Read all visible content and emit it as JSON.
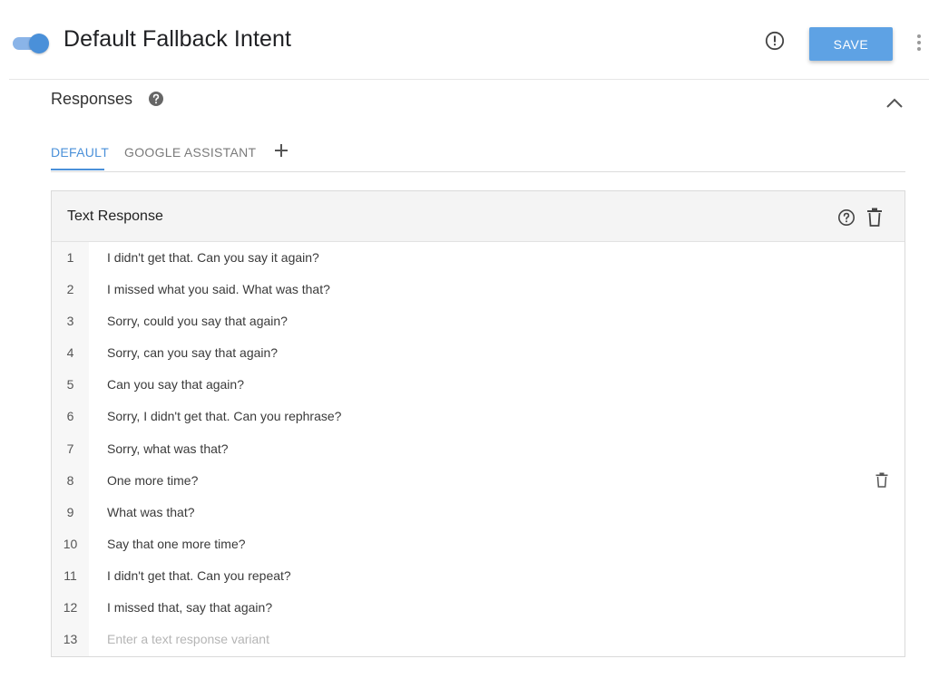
{
  "header": {
    "title": "Default Fallback Intent",
    "toggle_state": "on",
    "save_label": "SAVE",
    "accent_color": "#5ea2e4"
  },
  "responses": {
    "section_title": "Responses",
    "tabs": [
      {
        "label": "DEFAULT",
        "active": true
      },
      {
        "label": "GOOGLE ASSISTANT",
        "active": false
      }
    ],
    "card": {
      "title": "Text Response",
      "rows": [
        {
          "num": "1",
          "text": "I didn't get that. Can you say it again?"
        },
        {
          "num": "2",
          "text": "I missed what you said. What was that?"
        },
        {
          "num": "3",
          "text": "Sorry, could you say that again?"
        },
        {
          "num": "4",
          "text": "Sorry, can you say that again?"
        },
        {
          "num": "5",
          "text": "Can you say that again?"
        },
        {
          "num": "6",
          "text": "Sorry, I didn't get that. Can you rephrase?"
        },
        {
          "num": "7",
          "text": "Sorry, what was that?"
        },
        {
          "num": "8",
          "text": "One more time?"
        },
        {
          "num": "9",
          "text": "What was that?"
        },
        {
          "num": "10",
          "text": "Say that one more time?"
        },
        {
          "num": "11",
          "text": "I didn't get that. Can you repeat?"
        },
        {
          "num": "12",
          "text": "I missed that, say that again?"
        }
      ],
      "new_row": {
        "num": "13",
        "placeholder": "Enter a text response variant",
        "value": ""
      }
    }
  },
  "icons": {
    "toggle": "toggle-switch-icon",
    "alert": "alert-circle-icon",
    "more": "more-vertical-icon",
    "help_filled": "help-circle-filled-icon",
    "collapse": "chevron-up-icon",
    "add": "plus-icon",
    "card_help": "help-circle-outline-icon",
    "delete": "trash-icon"
  }
}
